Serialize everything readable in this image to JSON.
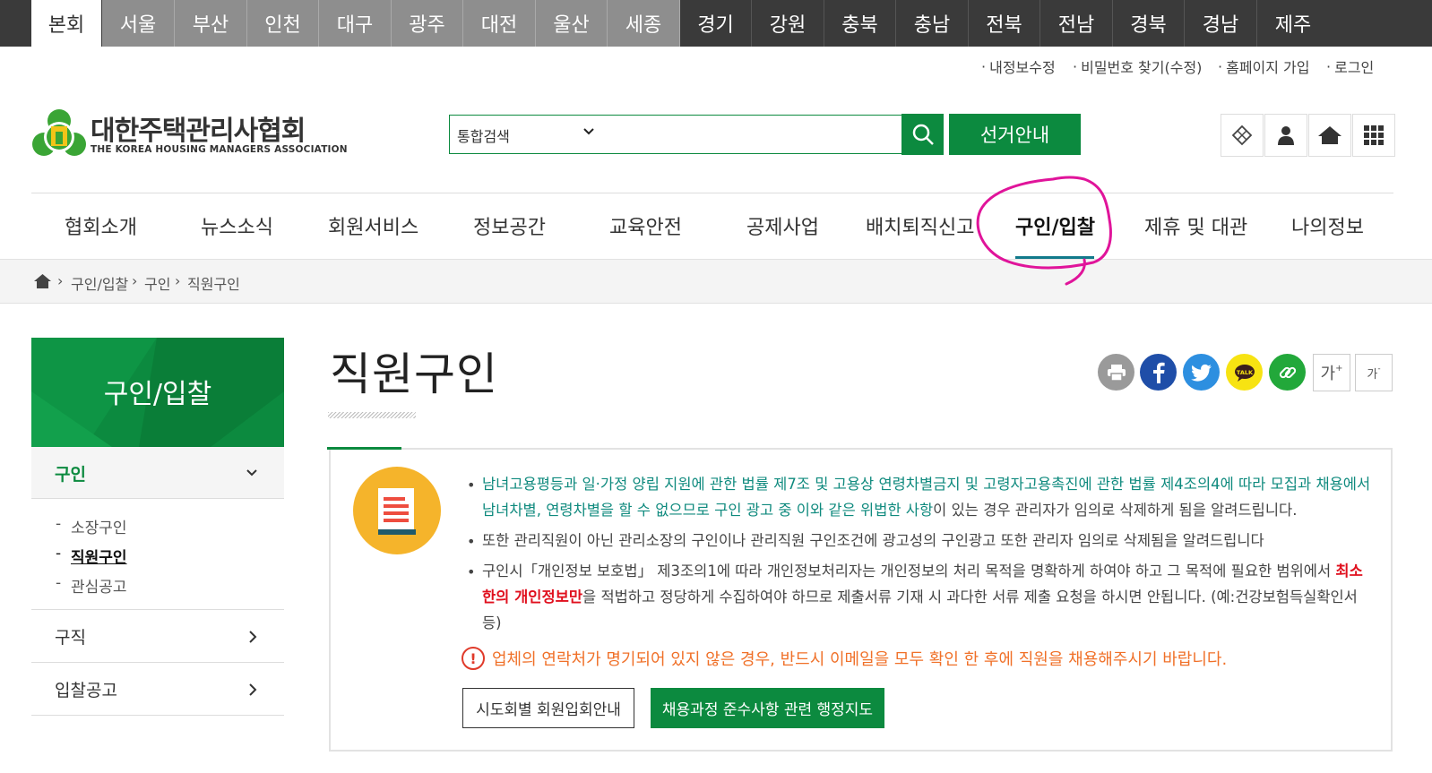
{
  "region_tabs": [
    "본회",
    "서울",
    "부산",
    "인천",
    "대구",
    "광주",
    "대전",
    "울산",
    "세종",
    "경기",
    "강원",
    "충북",
    "충남",
    "전북",
    "전남",
    "경북",
    "경남",
    "제주"
  ],
  "util_links": [
    "내정보수정",
    "비밀번호 찾기(수정)",
    "홈페이지 가입",
    "로그인"
  ],
  "logo": {
    "title": "대한주택관리사협회",
    "subtitle": "THE KOREA HOUSING MANAGERS ASSOCIATION"
  },
  "search": {
    "scope": "통합검색",
    "button_icon": "search-icon"
  },
  "election_button": "선거안내",
  "header_icons": [
    "sitemap-badge-icon",
    "user-icon",
    "home-icon",
    "grid-menu-icon"
  ],
  "gnb": [
    "협회소개",
    "뉴스소식",
    "회원서비스",
    "정보공간",
    "교육안전",
    "공제사업",
    "배치퇴직신고",
    "구인/입찰",
    "제휴 및 대관",
    "나의정보"
  ],
  "gnb_active": "구인/입찰",
  "breadcrumb": [
    "구인/입찰",
    "구인",
    "직원구인"
  ],
  "side_menu": {
    "title": "구인/입찰",
    "section1": {
      "label": "구인",
      "items": [
        "소장구인",
        "직원구인",
        "관심공고"
      ],
      "active": "직원구인"
    },
    "section2": {
      "label": "구직"
    },
    "section3": {
      "label": "입찰공고"
    }
  },
  "page_title": "직원구인",
  "share_icons": [
    "print-icon",
    "facebook-icon",
    "twitter-icon",
    "kakaotalk-icon",
    "link-icon"
  ],
  "font_buttons": {
    "increase": "가",
    "decrease": "가"
  },
  "notice": {
    "p1_line1": "남녀고용평등과 일·가정 양립 지원에 관한 법률 제7조 및 고용상 연령차별금지 및 고령자고용촉진에 관한 법률 제4조의4에 따라 모집과 채용에서",
    "p1_line2_teal": "남녀차별, 연령차별을 할 수 없으므로 구인 광고 중 이와 같은 위법한 사항",
    "p1_line2_rest": "이 있는 경우 관리자가 임의로 삭제하게 됨을 알려드립니다.",
    "p2": "또한 관리직원이 아닌 관리소장의 구인이나 관리직원 구인조건에 광고성의 구인광고 또한 관리자 임의로 삭제됨을 알려드립니다",
    "p3_pre": "구인시「개인정보 보호법」 제3조의1에 따라 개인정보처리자는 개인정보의 처리 목적을 명확하게 하여야 하고 그 목적에 필요한 범위에서 ",
    "p3_red1": "최소",
    "p3_red2": "한의 개인정보만",
    "p3_post": "을 적법하고 정당하게 수집하여야 하므로 제출서류 기재 시 과다한 서류 제출 요청을 하시면 안됩니다. (예:건강보험득실확인서",
    "p3_end": "등)",
    "warning": "업체의 연락처가 명기되어 있지 않은 경우, 반드시 이메일을 모두 확인 한 후에 직원을 채용해주시기 바랍니다.",
    "button1": "시도회별 회원입회안내",
    "button2": "채용과정 준수사항 관련 행정지도"
  },
  "colors": {
    "brand_green": "#0c8a3f",
    "annotation": "#e0149a",
    "warning_orange": "#f07028"
  }
}
